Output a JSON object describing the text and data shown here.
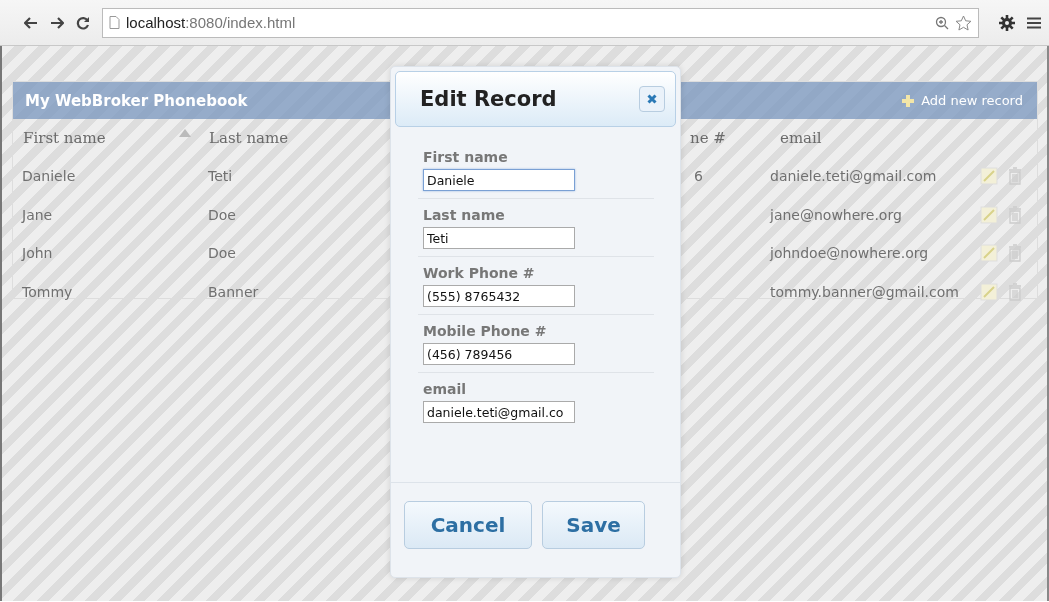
{
  "browser": {
    "url_host": "localhost",
    "url_path": ":8080/index.html"
  },
  "app": {
    "title": "My WebBroker Phonebook",
    "add_button": "Add new record"
  },
  "table": {
    "columns": [
      {
        "label": "First name",
        "sorted": true
      },
      {
        "label": "Last name",
        "sorted": false
      },
      {
        "label": "ne #",
        "sorted": false
      },
      {
        "label": "email",
        "sorted": false
      }
    ],
    "rows": [
      {
        "first": "Daniele",
        "last": "Teti",
        "column_3": "6",
        "email": "daniele.teti@gmail.com"
      },
      {
        "first": "Jane",
        "last": "Doe",
        "column_3": "",
        "email": "jane@nowhere.org"
      },
      {
        "first": "John",
        "last": "Doe",
        "column_3": "",
        "email": "johndoe@nowhere.org"
      },
      {
        "first": "Tommy",
        "last": "Banner",
        "column_3": "",
        "email": "tommy.banner@gmail.com"
      }
    ]
  },
  "dialog": {
    "title": "Edit Record",
    "fields": [
      {
        "label": "First name",
        "value": "Daniele",
        "focused": true
      },
      {
        "label": "Last name",
        "value": "Teti",
        "focused": false
      },
      {
        "label": "Work Phone #",
        "value": "(555) 8765432",
        "focused": false
      },
      {
        "label": "Mobile Phone #",
        "value": "(456) 789456",
        "focused": false
      },
      {
        "label": "email",
        "value": "daniele.teti@gmail.co",
        "focused": false
      }
    ],
    "buttons": [
      "Cancel",
      "Save"
    ]
  }
}
